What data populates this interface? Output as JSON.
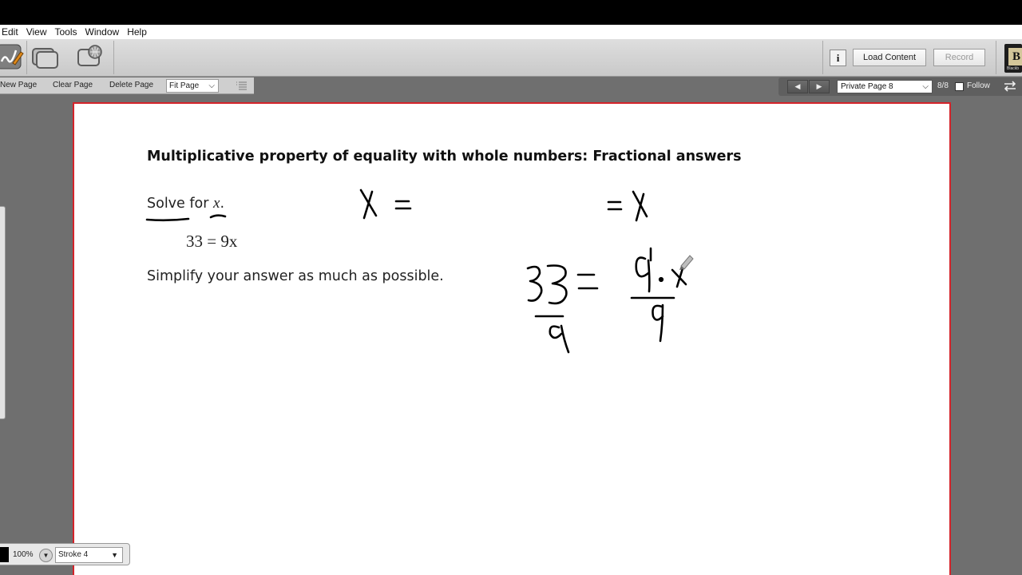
{
  "menu": [
    "Edit",
    "View",
    "Tools",
    "Window",
    "Help"
  ],
  "toolbar": {
    "info_label": "i",
    "load_content": "Load Content",
    "record": "Record",
    "logo_letter": "B",
    "logo_text": "Blackb"
  },
  "subbar": {
    "new_page": "New Page",
    "clear_page": "Clear Page",
    "delete_page": "Delete Page",
    "fit_page": "Fit Page"
  },
  "navigation": {
    "prev_symbol": "◀",
    "next_symbol": "▶",
    "page_select": "Private Page 8",
    "page_count": "8/8",
    "follow": "Follow",
    "follow_checked": false
  },
  "whiteboard": {
    "title": "Multiplicative property of equality with whole numbers: Fractional answers",
    "solve_prefix": "Solve for ",
    "solve_var": "x",
    "solve_suffix": ".",
    "equation": "33 = 9x",
    "simplify": "Simplify your answer as much as possible.",
    "border_color": "#d4232a"
  },
  "bottom": {
    "zoom": "100%",
    "stroke": "Stroke 4",
    "ink_color": "#000000"
  },
  "chevron": "⌵",
  "dropdown_arrow": "▼"
}
